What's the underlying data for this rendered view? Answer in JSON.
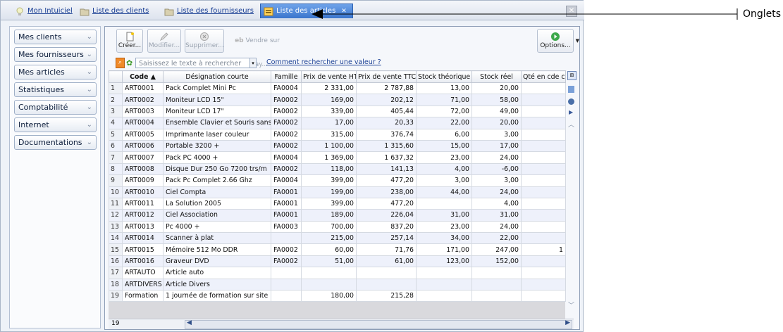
{
  "tabs": [
    {
      "label": "Mon Intuiciel",
      "icon": "bulb-icon"
    },
    {
      "label": "Liste des clients",
      "icon": "folder-icon"
    },
    {
      "label": "Liste des fournisseurs",
      "icon": "folder-icon"
    },
    {
      "label": "Liste des articles",
      "icon": "list-icon",
      "active": true
    }
  ],
  "sidebar": {
    "items": [
      {
        "label": "Mes clients"
      },
      {
        "label": "Mes fournisseurs"
      },
      {
        "label": "Mes articles"
      },
      {
        "label": "Statistiques"
      },
      {
        "label": "Comptabilité"
      },
      {
        "label": "Internet"
      },
      {
        "label": "Documentations"
      }
    ]
  },
  "toolbar": {
    "create": "Créer...",
    "modify": "Modifier...",
    "delete": "Supprimer...",
    "ebay": "Vendre sur eBay...",
    "options": "Options..."
  },
  "search": {
    "placeholder": "Saisissez le texte à rechercher",
    "help_link": "Comment rechercher une valeur ?"
  },
  "table": {
    "headers": [
      "Code",
      "Désignation courte",
      "Famille",
      "Prix de vente HT",
      "Prix de vente TTC",
      "Stock théorique",
      "Stock réel",
      "Qté en cde cl"
    ],
    "rows": [
      [
        "1",
        "ART0001",
        "Pack Complet Mini Pc",
        "FA0004",
        "2 331,00",
        "2 787,88",
        "13,00",
        "20,00",
        ""
      ],
      [
        "2",
        "ART0002",
        "Moniteur LCD 15\"",
        "FA0002",
        "169,00",
        "202,12",
        "71,00",
        "58,00",
        ""
      ],
      [
        "3",
        "ART0003",
        "Moniteur LCD 17\"",
        "FA0002",
        "339,00",
        "405,44",
        "72,00",
        "49,00",
        ""
      ],
      [
        "4",
        "ART0004",
        "Ensemble Clavier et Souris sans Fil",
        "FA0002",
        "17,00",
        "20,33",
        "22,00",
        "20,00",
        ""
      ],
      [
        "5",
        "ART0005",
        "Imprimante laser couleur",
        "FA0002",
        "315,00",
        "376,74",
        "6,00",
        "3,00",
        ""
      ],
      [
        "6",
        "ART0006",
        "Portable 3200 +",
        "FA0002",
        "1 100,00",
        "1 315,60",
        "15,00",
        "17,00",
        ""
      ],
      [
        "7",
        "ART0007",
        "Pack PC 4000 +",
        "FA0004",
        "1 369,00",
        "1 637,32",
        "23,00",
        "24,00",
        ""
      ],
      [
        "8",
        "ART0008",
        "Disque Dur 250 Go 7200 trs/m",
        "FA0002",
        "118,00",
        "141,13",
        "4,00",
        "-6,00",
        ""
      ],
      [
        "9",
        "ART0009",
        "Pack Pc Complet 2.66 Ghz",
        "FA0004",
        "399,00",
        "477,20",
        "3,00",
        "3,00",
        ""
      ],
      [
        "10",
        "ART0010",
        "Ciel Compta",
        "FA0001",
        "199,00",
        "238,00",
        "44,00",
        "24,00",
        ""
      ],
      [
        "11",
        "ART0011",
        "La Solution 2005",
        "FA0001",
        "399,00",
        "477,20",
        "",
        "4,00",
        ""
      ],
      [
        "12",
        "ART0012",
        "Ciel Association",
        "FA0001",
        "189,00",
        "226,04",
        "31,00",
        "31,00",
        ""
      ],
      [
        "13",
        "ART0013",
        "Pc 4000 +",
        "FA0003",
        "700,00",
        "837,20",
        "23,00",
        "24,00",
        ""
      ],
      [
        "14",
        "ART0014",
        "Scanner à plat",
        "",
        "215,00",
        "257,14",
        "34,00",
        "22,00",
        ""
      ],
      [
        "15",
        "ART0015",
        "Mémoire 512 Mo DDR",
        "FA0002",
        "60,00",
        "71,76",
        "171,00",
        "247,00",
        "1"
      ],
      [
        "16",
        "ART0016",
        "Graveur DVD",
        "FA0002",
        "51,00",
        "61,00",
        "123,00",
        "152,00",
        ""
      ],
      [
        "17",
        "ARTAUTO",
        "Article auto",
        "",
        "",
        "",
        "",
        "",
        ""
      ],
      [
        "18",
        "ARTDIVERS",
        "Article Divers",
        "",
        "",
        "",
        "",
        "",
        ""
      ],
      [
        "19",
        "Formation",
        "1 journée de formation sur site",
        "",
        "180,00",
        "215,28",
        "",
        "",
        ""
      ]
    ]
  },
  "status": {
    "count": "19"
  },
  "annotation": {
    "label": "Onglets"
  }
}
